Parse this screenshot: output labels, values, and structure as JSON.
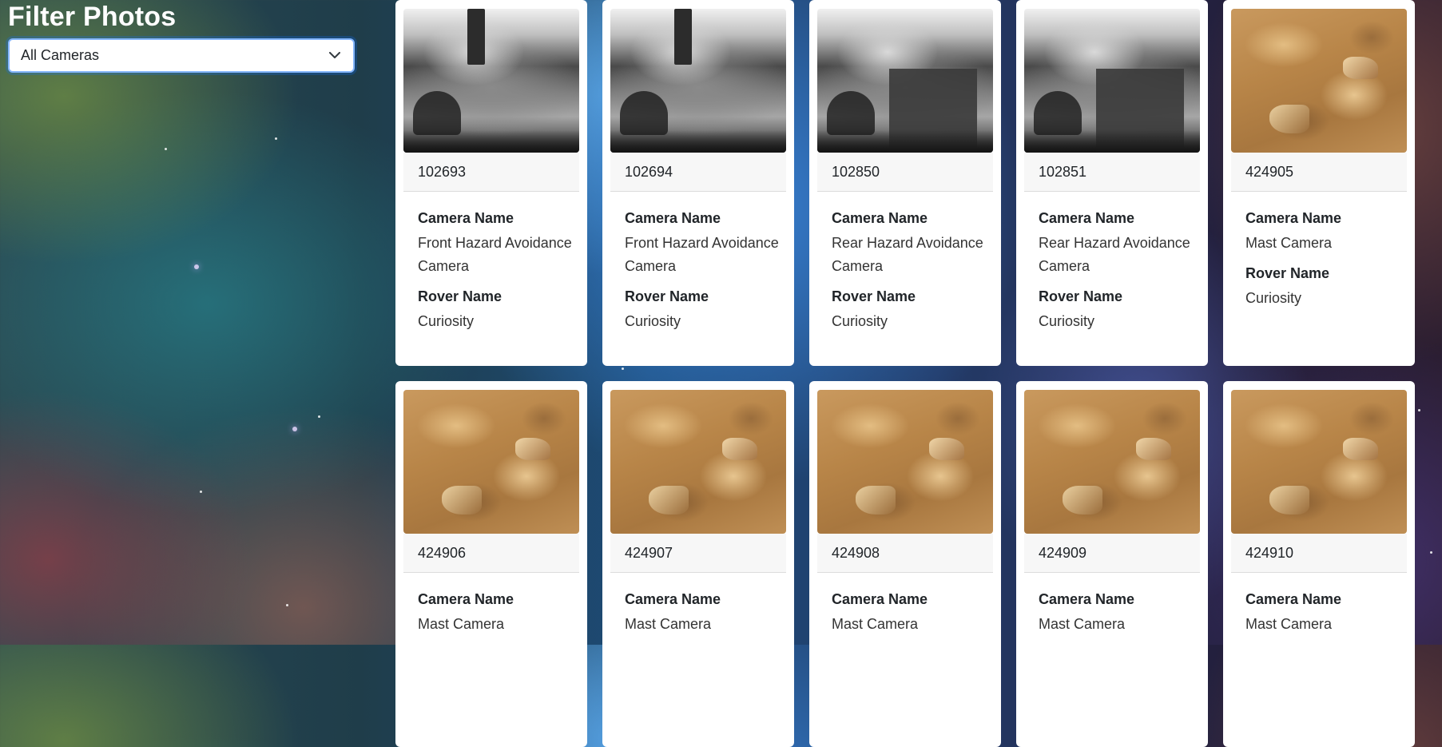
{
  "filter": {
    "title": "Filter Photos",
    "selected": "All Cameras"
  },
  "labels": {
    "camera": "Camera Name",
    "rover": "Rover Name"
  },
  "photos": [
    {
      "id": "102693",
      "camera": "Front Hazard Avoidance Camera",
      "rover": "Curiosity",
      "image": "rover-hazcam-photo"
    },
    {
      "id": "102694",
      "camera": "Front Hazard Avoidance Camera",
      "rover": "Curiosity",
      "image": "rover-hazcam-photo"
    },
    {
      "id": "102850",
      "camera": "Rear Hazard Avoidance Camera",
      "rover": "Curiosity",
      "image": "rover-hazcam-photo"
    },
    {
      "id": "102851",
      "camera": "Rear Hazard Avoidance Camera",
      "rover": "Curiosity",
      "image": "rover-hazcam-photo"
    },
    {
      "id": "424905",
      "camera": "Mast Camera",
      "rover": "Curiosity",
      "image": "mars-terrain-photo"
    },
    {
      "id": "424906",
      "camera": "Mast Camera",
      "rover": "",
      "image": "mars-terrain-photo"
    },
    {
      "id": "424907",
      "camera": "Mast Camera",
      "rover": "",
      "image": "mars-terrain-photo"
    },
    {
      "id": "424908",
      "camera": "Mast Camera",
      "rover": "",
      "image": "mars-terrain-photo"
    },
    {
      "id": "424909",
      "camera": "Mast Camera",
      "rover": "",
      "image": "mars-terrain-photo"
    },
    {
      "id": "424910",
      "camera": "Mast Camera",
      "rover": "",
      "image": "mars-terrain-photo"
    }
  ]
}
